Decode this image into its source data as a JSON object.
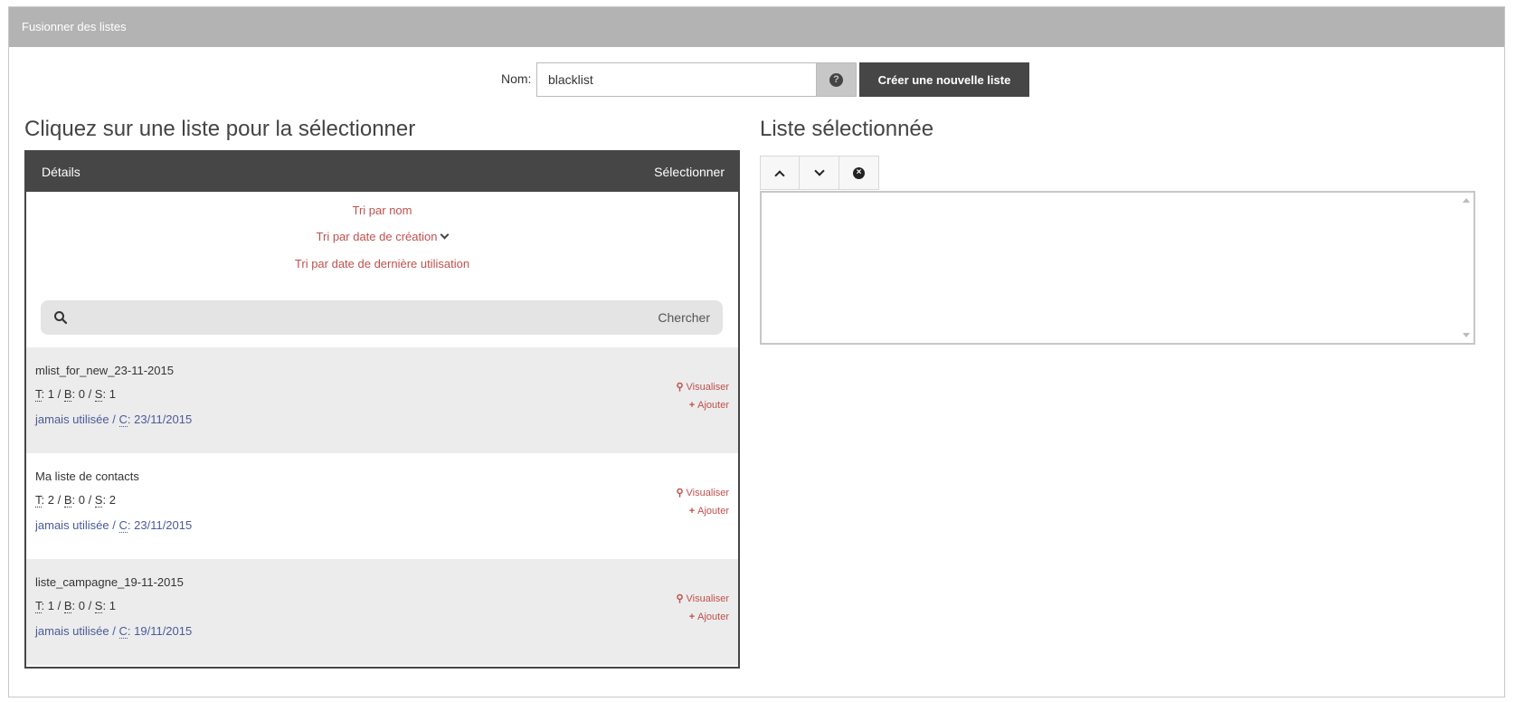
{
  "panel": {
    "title": "Fusionner des listes"
  },
  "name_form": {
    "label": "Nom:",
    "value": "blacklist",
    "help_icon": "question-circle-icon",
    "create_label": "Créer une nouvelle liste"
  },
  "left": {
    "title": "Cliquez sur une liste pour la sélectionner",
    "header_details": "Détails",
    "header_select": "Sélectionner",
    "sort_name": "Tri par nom",
    "sort_created": "Tri par date de création",
    "sort_last_used": "Tri par date de dernière utilisation",
    "search_label": "Chercher",
    "lists": [
      {
        "name": "mlist_for_new_23-11-2015",
        "t_label": "T",
        "t": "1",
        "b_label": "B",
        "b": "0",
        "s_label": "S",
        "s": "1",
        "usage": "jamais utilisée",
        "c_label": "C",
        "created": "23/11/2015",
        "view_label": "Visualiser",
        "add_label": "Ajouter"
      },
      {
        "name": "Ma liste de contacts",
        "t_label": "T",
        "t": "2",
        "b_label": "B",
        "b": "0",
        "s_label": "S",
        "s": "2",
        "usage": "jamais utilisée",
        "c_label": "C",
        "created": "23/11/2015",
        "view_label": "Visualiser",
        "add_label": "Ajouter"
      },
      {
        "name": "liste_campagne_19-11-2015",
        "t_label": "T",
        "t": "1",
        "b_label": "B",
        "b": "0",
        "s_label": "S",
        "s": "1",
        "usage": "jamais utilisée",
        "c_label": "C",
        "created": "19/11/2015",
        "view_label": "Visualiser",
        "add_label": "Ajouter"
      }
    ]
  },
  "right": {
    "title": "Liste sélectionnée",
    "toolbar_icons": [
      "chevron-up-icon",
      "chevron-down-icon",
      "remove-circle-icon"
    ]
  },
  "colors": {
    "header_bg": "#b3b3b3",
    "dark": "#464646",
    "link_red": "#c0504d",
    "date_blue": "#4a5a9a",
    "row_alt": "#ececec"
  }
}
